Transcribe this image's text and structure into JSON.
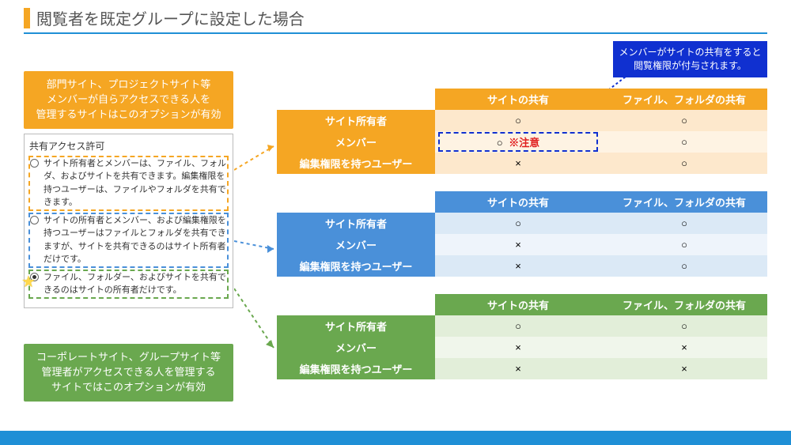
{
  "title": "閲覧者を既定グループに設定した場合",
  "top_banner": {
    "line1": "メンバーがサイトの共有をすると",
    "line2": "閲覧権限が付与されます。"
  },
  "callouts": {
    "orange": "部門サイト、プロジェクトサイト等\nメンバーが自らアクセスできる人を\n管理するサイトはこのオプションが有効",
    "green": "コーポレートサイト、グループサイト等\n管理者がアクセスできる人を管理する\nサイトではこのオプションが有効"
  },
  "perm_box": {
    "title": "共有アクセス許可",
    "options": [
      "サイト所有者とメンバーは、ファイル、フォルダ、およびサイトを共有できます。編集権限を持つユーザーは、ファイルやフォルダを共有できます。",
      "サイトの所有者とメンバー、および編集権限を持つユーザーはファイルとフォルダを共有できますが、サイトを共有できるのはサイト所有者だけです。",
      "ファイル、フォルダー、およびサイトを共有できるのはサイトの所有者だけです。"
    ],
    "selected": 2
  },
  "columns": {
    "col1": "サイトの共有",
    "col2": "ファイル、フォルダの共有"
  },
  "rows": {
    "r1": "サイト所有者",
    "r2": "メンバー",
    "r3": "編集権限を持つユーザー"
  },
  "warn": "※注意",
  "marks": {
    "yes": "○",
    "no": "×"
  },
  "tables": {
    "orange": {
      "values": [
        [
          "yes",
          "yes"
        ],
        [
          "yes",
          "yes"
        ],
        [
          "no",
          "yes"
        ]
      ],
      "warn_row": 1
    },
    "blue": {
      "values": [
        [
          "yes",
          "yes"
        ],
        [
          "no",
          "yes"
        ],
        [
          "no",
          "yes"
        ]
      ]
    },
    "green": {
      "values": [
        [
          "yes",
          "yes"
        ],
        [
          "no",
          "no"
        ],
        [
          "no",
          "no"
        ]
      ]
    }
  }
}
